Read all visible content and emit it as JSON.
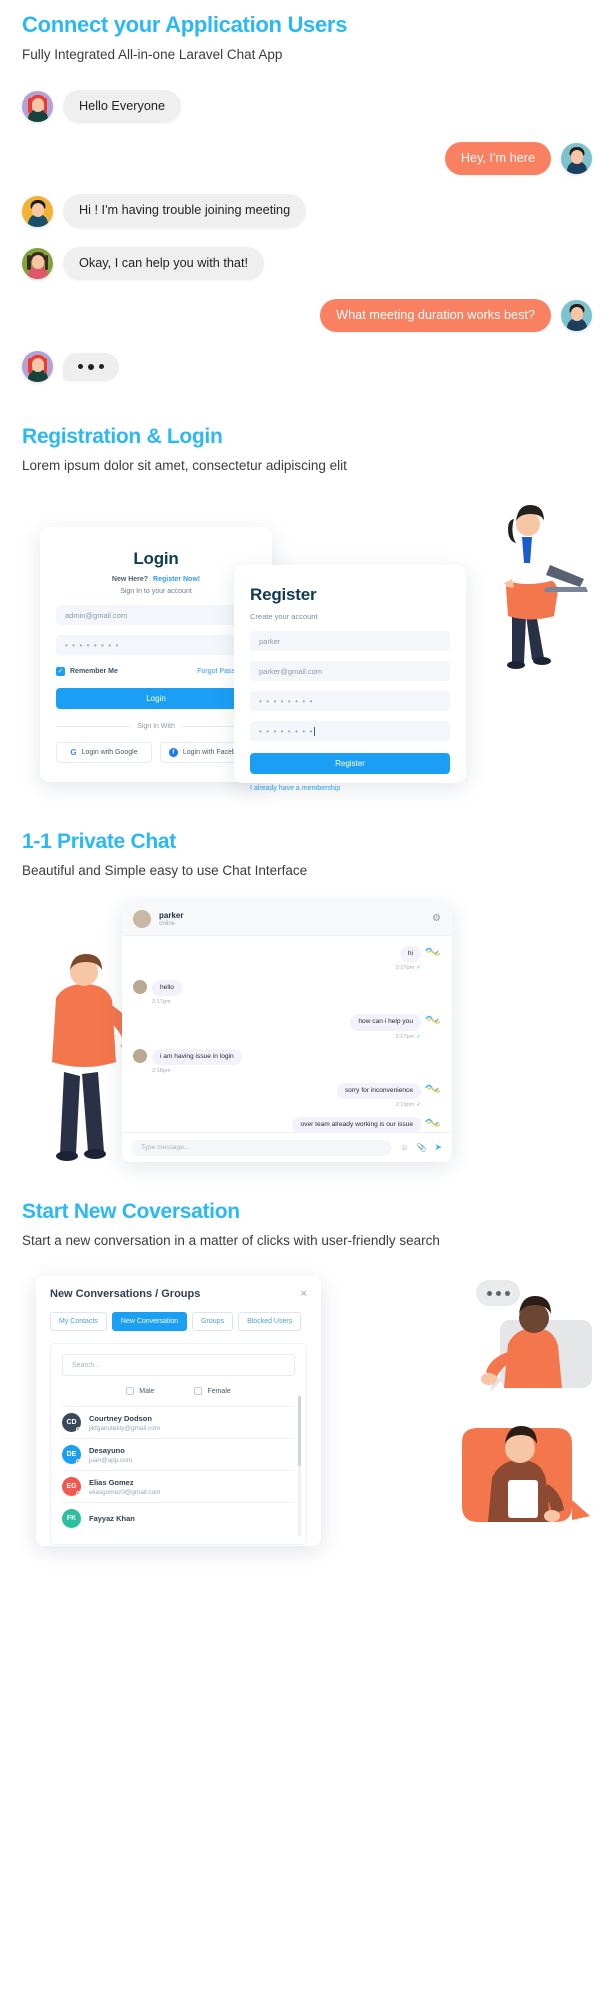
{
  "hero": {
    "title": "Connect your Application Users",
    "subtitle": "Fully Integrated All-in-one Laravel Chat App",
    "messages": [
      {
        "text": "Hello Everyone",
        "side": "left",
        "avatar": "redhair-woman"
      },
      {
        "text": "Hey, I'm here",
        "side": "right",
        "avatar": "glasses-man"
      },
      {
        "text": "Hi ! I'm having trouble joining meeting",
        "side": "left",
        "avatar": "yellow-man"
      },
      {
        "text": "Okay, I can help you with that!",
        "side": "left",
        "avatar": "green-woman"
      },
      {
        "text": "What meeting duration works best?",
        "side": "right",
        "avatar": "glasses-man"
      }
    ],
    "typing_indicator": "..."
  },
  "registration": {
    "title": "Registration & Login",
    "subtitle": "Lorem ipsum dolor sit amet, consectetur adipiscing elit",
    "login_card": {
      "title": "Login",
      "new_here": "New Here?",
      "register_now": "Register Now!",
      "sign_in_hint": "Sign In to your account",
      "email_value": "admin@gmail.com",
      "password_value": "• • • • • • • •",
      "remember_label": "Remember Me",
      "forgot_label": "Forgot Password ?",
      "login_button": "Login",
      "divider": "Sign In With",
      "google_button": "Login with Google",
      "facebook_button": "Login with Facebook"
    },
    "register_card": {
      "title": "Register",
      "subtitle": "Create your account",
      "name_value": "parker",
      "email_value": "parker@gmail.com",
      "password_value": "• • • • • • • •",
      "confirm_value": "• • • • • • • •",
      "register_button": "Register",
      "membership_link": "I already have a membership"
    }
  },
  "private_chat": {
    "title": "1-1 Private Chat",
    "subtitle": "Beautiful and Simple easy to use Chat Interface",
    "window": {
      "contact_name": "parker",
      "contact_status": "online",
      "gear_icon": "gear-icon",
      "input_placeholder": "Type message...",
      "messages": [
        {
          "text": "hi",
          "time": "2:17pm",
          "side": "out"
        },
        {
          "text": "hello",
          "time": "2:17pm",
          "side": "in"
        },
        {
          "text": "how can i help you",
          "time": "2:17pm",
          "side": "out"
        },
        {
          "text": "i am having issue in login",
          "time": "2:18pm",
          "side": "in"
        },
        {
          "text": "sorry for inconvenience",
          "time": "2:19pm",
          "side": "out"
        },
        {
          "text": "over team already working is our issue",
          "time": "",
          "side": "out"
        }
      ]
    }
  },
  "new_conversation": {
    "title": "Start New Coversation",
    "subtitle": "Start a new conversation in a matter of clicks with user-friendly search",
    "modal": {
      "title": "New Conversations / Groups",
      "close_icon": "close-icon",
      "tabs": [
        {
          "label": "My Contacts",
          "active": false
        },
        {
          "label": "New Conversation",
          "active": true
        },
        {
          "label": "Groups",
          "active": false
        },
        {
          "label": "Blocked Users",
          "active": false
        }
      ],
      "search_placeholder": "Search...",
      "filters": [
        {
          "label": "Male",
          "checked": false
        },
        {
          "label": "Female",
          "checked": false
        }
      ],
      "contacts": [
        {
          "name": "Courtney Dodson",
          "email": "jikfganutekty@gmail.com",
          "initials": "CD",
          "color": "#3a4a5c"
        },
        {
          "name": "Desayuno",
          "email": "juan@app.com",
          "initials": "DE",
          "color": "#1a9ff5"
        },
        {
          "name": "Elias Gomez",
          "email": "eliasgomez0@gmail.com",
          "initials": "EG",
          "color": "#f2584f"
        },
        {
          "name": "Fayyaz Khan",
          "email": "",
          "initials": "FK",
          "color": "#2bbf9e"
        }
      ]
    }
  },
  "colors": {
    "accent_blue": "#2bb8f4",
    "primary_blue": "#1a9ff5",
    "orange": "#f98060",
    "bubble_grey": "#efeff0"
  }
}
